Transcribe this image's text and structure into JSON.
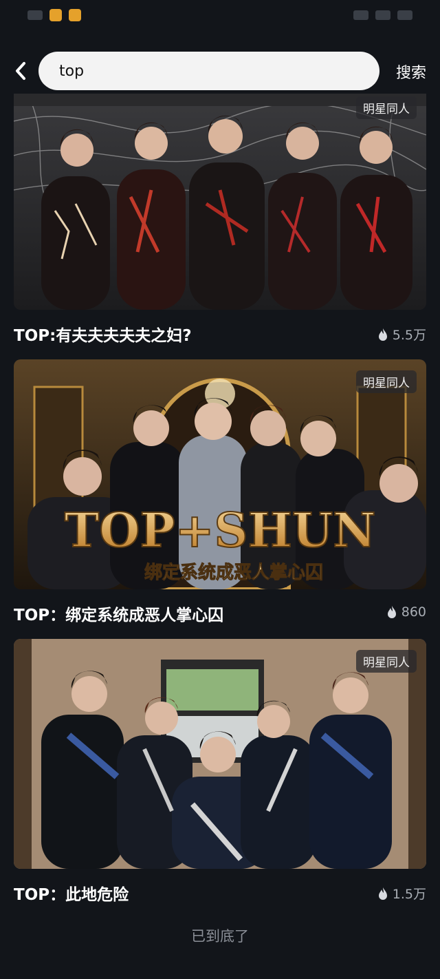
{
  "search": {
    "value": "top",
    "button_label": "搜索"
  },
  "results": [
    {
      "badge": "明星同人",
      "title": "TOP:有夫夫夫夫夫之妇?",
      "views": "5.5万"
    },
    {
      "badge": "明星同人",
      "title": "TOP：绑定系统成恶人掌心囚",
      "views": "860",
      "cover_text_main": "TOP+SHUN",
      "cover_text_sub": "绑定系统成恶人掌心囚"
    },
    {
      "badge": "明星同人",
      "title": "TOP：此地危险",
      "views": "1.5万"
    }
  ],
  "footer": {
    "end_text": "已到底了"
  },
  "icons": {
    "back": "chevron-left-icon",
    "views": "flame-icon"
  },
  "colors": {
    "background": "#12151a",
    "input_bg": "#f3f3f3",
    "title": "#ffffff",
    "meta": "#a9aeb5"
  }
}
